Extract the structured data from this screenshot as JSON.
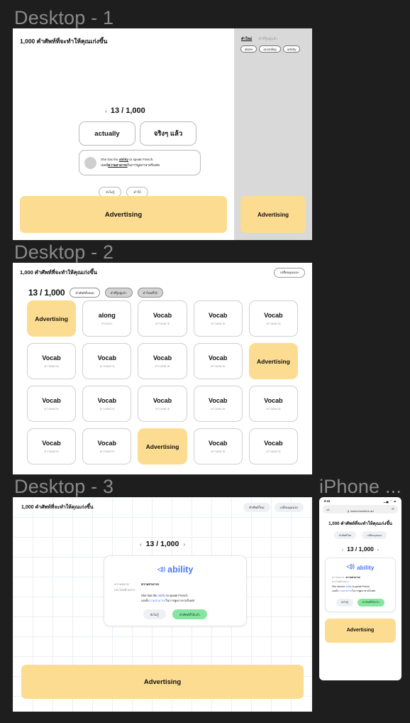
{
  "frames": {
    "desktop1_label": "Desktop - 1",
    "desktop2_label": "Desktop - 2",
    "desktop3_label": "Desktop - 3",
    "iphone_label": "iPhone ..."
  },
  "app": {
    "title": "1,000 คำศัพท์ที่จะทำให้คุณเก่งขึ้น",
    "counter": "13 / 1,000",
    "prev_arrow": "‹",
    "next_arrow": "›",
    "ad_label": "Advertising",
    "word_en": "ability",
    "word_th": "ความสามารถ",
    "example_en_prefix": "She has the ",
    "example_en_word": "ability",
    "example_en_suffix": " to speak French.",
    "example_th_prefix": "เธอมี",
    "example_th_word": "ความสามารถ",
    "example_th_suffix": "ในการพูดภาษาฝรั่งเศส",
    "choice_en": "actually",
    "choice_th": "จริงๆ แล้ว",
    "label_meaning": "ความหมาย :",
    "label_example": "ประโยคตัวอย่าง :"
  },
  "desktop1": {
    "tabs": [
      {
        "label": "คำใหม่",
        "active": true
      },
      {
        "label": "คำที่รู้อยู่แล้ว",
        "active": false
      }
    ],
    "chips": [
      "above",
      "according",
      "activity"
    ],
    "buttons": [
      "ยังไม่รู้",
      "คำใบ้"
    ]
  },
  "desktop2": {
    "header_button": "เปลี่ยนมุมมอง",
    "filters": [
      {
        "label": "คำศัพท์ทั้งหมด",
        "active": false
      },
      {
        "label": "คำที่รู้อยู่แล้ว",
        "active": true
      },
      {
        "label": "คำใหม่ที่ได้",
        "active": true
      }
    ],
    "grid": [
      [
        {
          "type": "ad",
          "word": "Advertising"
        },
        {
          "type": "vocab",
          "word": "along",
          "th": "ตามแนว"
        },
        {
          "type": "vocab",
          "word": "Vocab",
          "th": "ความหมาย"
        },
        {
          "type": "vocab",
          "word": "Vocab",
          "th": "ความหมาย"
        },
        {
          "type": "vocab",
          "word": "Vocab",
          "th": "ความหมาย"
        }
      ],
      [
        {
          "type": "vocab",
          "word": "Vocab",
          "th": "ความหมาย"
        },
        {
          "type": "vocab",
          "word": "Vocab",
          "th": "ความหมาย"
        },
        {
          "type": "vocab",
          "word": "Vocab",
          "th": "ความหมาย"
        },
        {
          "type": "vocab",
          "word": "Vocab",
          "th": "ความหมาย"
        },
        {
          "type": "ad",
          "word": "Advertising"
        }
      ],
      [
        {
          "type": "vocab",
          "word": "Vocab",
          "th": "ความหมาย"
        },
        {
          "type": "vocab",
          "word": "Vocab",
          "th": "ความหมาย"
        },
        {
          "type": "vocab",
          "word": "Vocab",
          "th": "ความหมาย"
        },
        {
          "type": "vocab",
          "word": "Vocab",
          "th": "ความหมาย"
        },
        {
          "type": "vocab",
          "word": "Vocab",
          "th": "ความหมาย"
        }
      ],
      [
        {
          "type": "vocab",
          "word": "Vocab",
          "th": "ความหมาย"
        },
        {
          "type": "vocab",
          "word": "Vocab",
          "th": "ความหมาย"
        },
        {
          "type": "ad",
          "word": "Advertising"
        },
        {
          "type": "vocab",
          "word": "Vocab",
          "th": "ความหมาย"
        },
        {
          "type": "vocab",
          "word": "Vocab",
          "th": "ความหมาย"
        }
      ]
    ]
  },
  "desktop3": {
    "actions": [
      "คำศัพท์ใหม่",
      "เปลี่ยนมุมมอง"
    ],
    "button_hint": "ยังไม่รู้",
    "button_known": "คำศัพท์ที่ได้แล้ว"
  },
  "iphone": {
    "status_time": "9:41",
    "status_icons": "▁▄ ⌃ ▰",
    "aa_label": "ᴀA",
    "address": "www.knowhere.art",
    "reload_icon": "⟳",
    "lock_icon": "🔒",
    "tabs": [
      "คำศัพท์ใหม่",
      "เปลี่ยนมุมมอง"
    ],
    "button_hint": "ยังไม่รู้",
    "button_known": "คำศัพท์ที่ได้แล้ว"
  },
  "colors": {
    "ad_yellow": "#fcdc90",
    "accent_blue": "#4b7bf5",
    "accent_green": "#86e6a0",
    "canvas_bg": "#1e1e1e"
  }
}
